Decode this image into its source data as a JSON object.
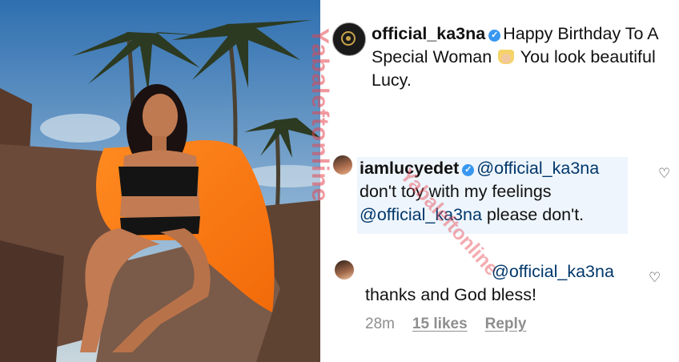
{
  "watermark": "Yabaleftonline",
  "post": {
    "username": "official_ka3na",
    "caption": "Happy Birthday To A Special Woman",
    "caption_end": "You look beautiful Lucy.",
    "emoji_icon": "princess-icon"
  },
  "comments": [
    {
      "username": "iamlucyedet",
      "mention": "@official_ka3na",
      "text_line": "don't toy with my feelings",
      "mention2": "@official_ka3na",
      "text_end": "please don't."
    },
    {
      "mention": "@official_ka3na",
      "text": "thanks and God bless!",
      "time": "28m",
      "likes": "15 likes",
      "reply": "Reply"
    }
  ],
  "colors": {
    "verified": "#3897f0",
    "mention": "#00376b",
    "highlight": "#eef5fc"
  }
}
